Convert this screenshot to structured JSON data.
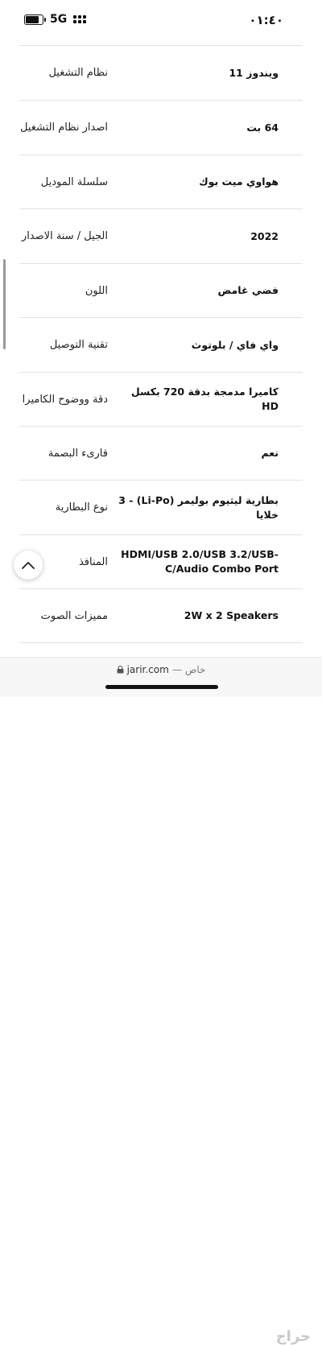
{
  "status_bar": {
    "time": "٠١:٤٠",
    "network": "5G",
    "battery_level": 0.85
  },
  "specs": [
    {
      "label": "نظام التشغيل",
      "value": "ويندوز 11"
    },
    {
      "label": "اصدار نظام التشغيل",
      "value": "64 بت"
    },
    {
      "label": "سلسلة الموديل",
      "value": "هواوي ميت بوك"
    },
    {
      "label": "الجيل / سنة الاصدار",
      "value": "2022"
    },
    {
      "label": "اللون",
      "value": "فضي غامض"
    },
    {
      "label": "تقنية التوصيل",
      "value": "واي فاي / بلوتوث"
    },
    {
      "label": "دقة ووضوح الكاميرا",
      "value": "كاميرا مدمجة بدقة 720 بكسل HD"
    },
    {
      "label": "قارىء البصمة",
      "value": "نعم"
    },
    {
      "label": "نوع البطارية",
      "value": "بطارية ليثيوم بوليمر (Li-Po) - 3 خلايا"
    },
    {
      "label": "المنافذ",
      "value": "HDMI/USB 2.0/USB 3.2/USB-C/Audio Combo Port"
    },
    {
      "label": "مميزات الصوت",
      "value": "2W x 2 Speakers"
    }
  ],
  "url_bar": {
    "domain": "jarir.com",
    "separator": "—",
    "mode": "خاص"
  },
  "watermark": "حراج"
}
